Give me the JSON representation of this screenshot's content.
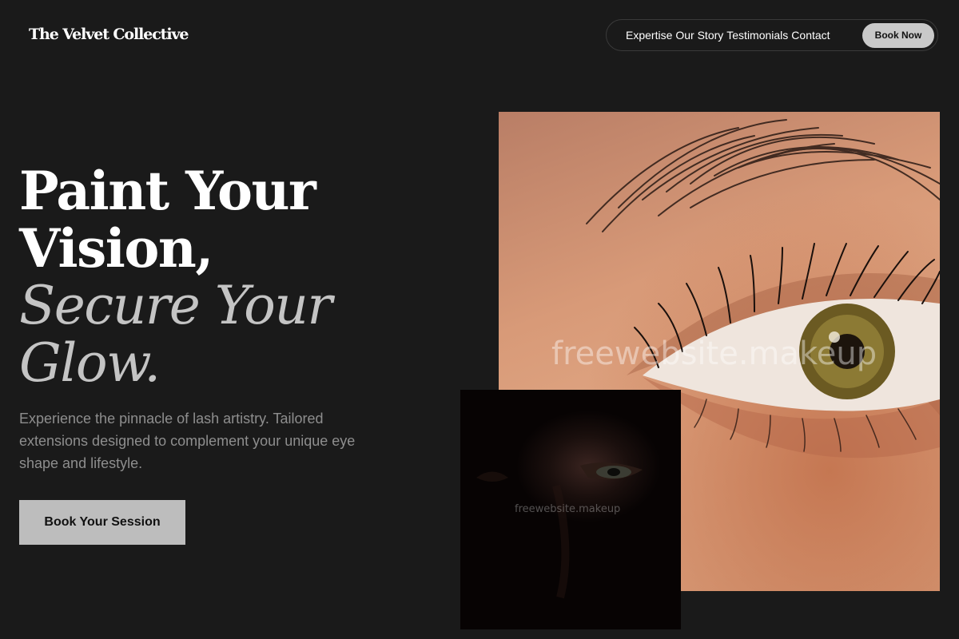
{
  "brand": {
    "name": "The Velvet Collective"
  },
  "nav": {
    "links": [
      "Expertise",
      "Our Story",
      "Testimonials",
      "Contact"
    ],
    "cta_label": "Book Now"
  },
  "hero": {
    "title_lines": [
      "Paint Your",
      "Vision,"
    ],
    "title_italic_lines": [
      "Secure Your",
      "Glow."
    ],
    "subtitle": "Experience the pinnacle of lash artistry. Tailored extensions designed to complement your unique eye shape and lifestyle.",
    "cta_label": "Book Your Session"
  },
  "images": {
    "primary_icon": "eye-closeup-photo",
    "secondary_icon": "shadowed-face-photo",
    "watermark": "freewebsite.makeup"
  },
  "colors": {
    "background": "#1a1a1a",
    "button": "#bdbdbd",
    "muted_text": "#8e8e8e",
    "italic_text": "#c4c4c4"
  }
}
